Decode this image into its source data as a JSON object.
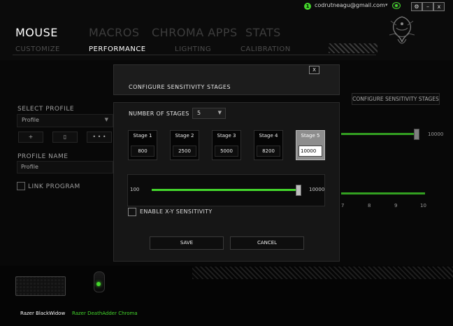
{
  "topbar": {
    "notification_count": "1",
    "user_email": "codrutneagu@gmail.com",
    "user_caret": "▾",
    "settings_label": "⚙",
    "minimize_label": "–",
    "close_label": "x"
  },
  "nav": {
    "main": [
      "MOUSE",
      "MACROS",
      "CHROMA APPS",
      "STATS"
    ],
    "sub": [
      "CUSTOMIZE",
      "PERFORMANCE",
      "LIGHTING",
      "CALIBRATION"
    ],
    "active_main": "MOUSE",
    "active_sub": "PERFORMANCE"
  },
  "left_panel": {
    "select_profile_label": "SELECT PROFILE",
    "profile_value": "Profile",
    "profile_caret": "▼",
    "add_label": "+",
    "delete_label": "▯",
    "more_label": "• • •",
    "profile_name_label": "PROFILE NAME",
    "profile_name_value": "Profile",
    "link_program_label": "LINK PROGRAM"
  },
  "right_panel": {
    "configure_button_label": "CONFIGURE SENSITIVITY STAGES",
    "slider_max": "10000",
    "ticks": [
      "7",
      "8",
      "9",
      "10"
    ]
  },
  "dialog": {
    "close_label": "X",
    "title": "CONFIGURE SENSITIVITY STAGES",
    "number_of_stages_label": "NUMBER OF STAGES",
    "number_of_stages_value": "5",
    "number_of_stages_caret": "▼",
    "stages": [
      {
        "name": "Stage 1",
        "value": "800"
      },
      {
        "name": "Stage 2",
        "value": "2500"
      },
      {
        "name": "Stage 3",
        "value": "5000"
      },
      {
        "name": "Stage 4",
        "value": "8200"
      },
      {
        "name": "Stage 5",
        "value": "10000"
      }
    ],
    "active_stage": 5,
    "slider": {
      "min": "100",
      "max": "10000",
      "value": 10000
    },
    "xy_label": "ENABLE X-Y SENSITIVITY",
    "save_label": "SAVE",
    "cancel_label": "CANCEL"
  },
  "devices": [
    {
      "name": "Razer BlackWidow",
      "color": "#ffffff"
    },
    {
      "name": "Razer DeathAdder Chroma",
      "color": "#44d62c"
    }
  ],
  "colors": {
    "accent": "#44d62c",
    "background": "#0b0b0b"
  }
}
